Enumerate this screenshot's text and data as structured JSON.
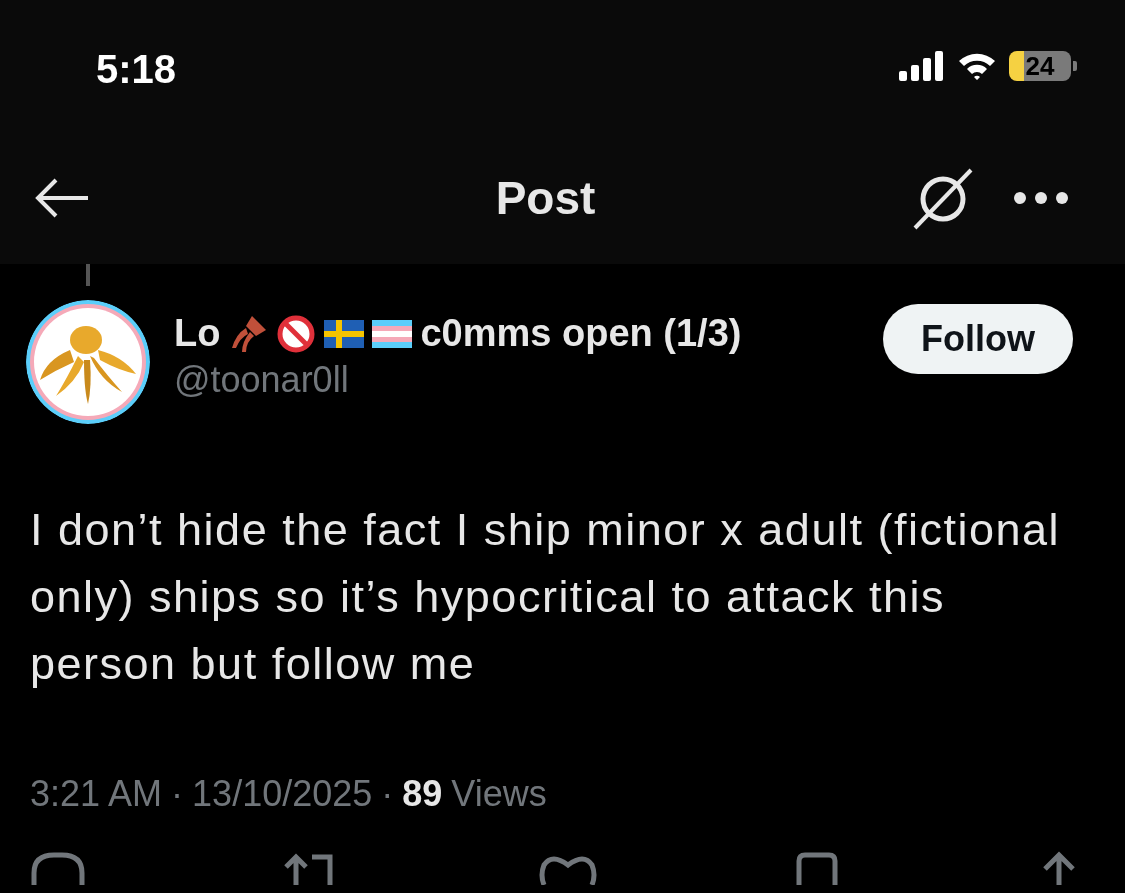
{
  "status_bar": {
    "time": "5:18",
    "battery_text": "24"
  },
  "header": {
    "title": "Post"
  },
  "post": {
    "author": {
      "name_start": "Lo",
      "name_end": "c0mms open (1/3)",
      "handle": "@toonar0ll"
    },
    "follow_button": "Follow",
    "text": "I don’t hide the fact I ship minor x adult (fictional only) ships so it’s hypocritical to attack this person but follow me",
    "meta": {
      "time": "3:21 AM",
      "separator_1": "·",
      "date": "13/10/2025",
      "separator_2": "·",
      "views_count": "89",
      "views_label": "Views"
    }
  }
}
